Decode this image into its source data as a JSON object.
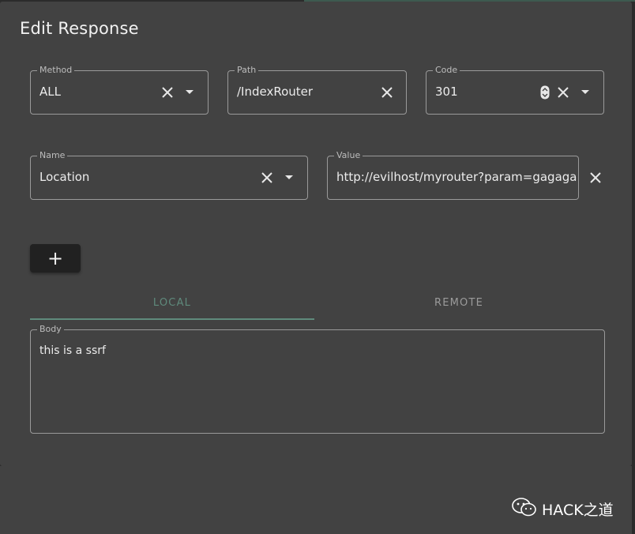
{
  "dialog": {
    "title": "Edit Response"
  },
  "method": {
    "label": "Method",
    "value": "ALL"
  },
  "path": {
    "label": "Path",
    "value": "/IndexRouter"
  },
  "code": {
    "label": "Code",
    "value": "301"
  },
  "header": {
    "name_label": "Name",
    "name_value": "Location",
    "value_label": "Value",
    "value_value": "http://evilhost/myrouter?param=gagaga"
  },
  "add_button": {
    "label": "+"
  },
  "tabs": [
    {
      "label": "LOCAL",
      "active": true
    },
    {
      "label": "REMOTE",
      "active": false
    }
  ],
  "body": {
    "label": "Body",
    "value": "this is a ssrf"
  },
  "watermark": {
    "text": "HACK之道"
  },
  "colors": {
    "dialog_bg": "#424242",
    "accent": "#5f8a7c",
    "border": "#9a9a9a"
  }
}
